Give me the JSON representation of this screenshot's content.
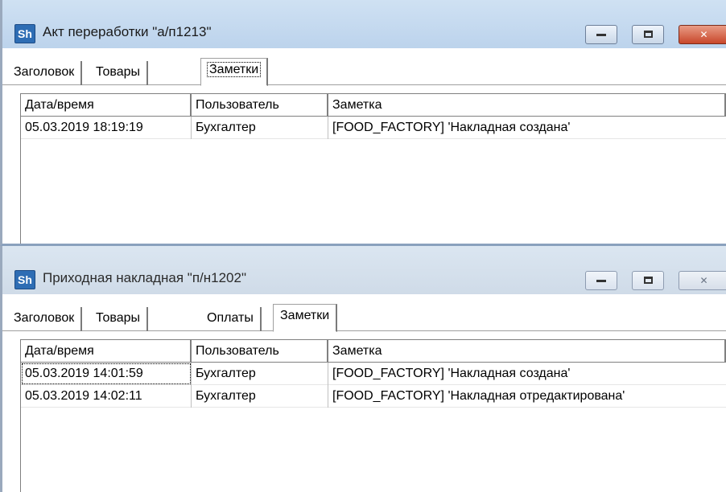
{
  "windows": [
    {
      "title": "Акт переработки \"а/п1213\"",
      "app_icon": "Sh",
      "tabs": [
        {
          "label": "Заголовок"
        },
        {
          "label": "Товары"
        },
        {
          "label": "Заметки"
        }
      ],
      "active_tab": "Заметки",
      "columns": [
        "Дата/время",
        "Пользователь",
        "Заметка"
      ],
      "rows": [
        [
          "05.03.2019 18:19:19",
          "Бухгалтер",
          "[FOOD_FACTORY] 'Накладная создана'"
        ]
      ]
    },
    {
      "title": "Приходная накладная \"п/н1202\"",
      "app_icon": "Sh",
      "tabs": [
        {
          "label": "Заголовок"
        },
        {
          "label": "Товары"
        },
        {
          "label": "Оплаты"
        },
        {
          "label": "Заметки"
        }
      ],
      "active_tab": "Заметки",
      "columns": [
        "Дата/время",
        "Пользователь",
        "Заметка"
      ],
      "rows": [
        [
          "05.03.2019 14:01:59",
          "Бухгалтер",
          "[FOOD_FACTORY] 'Накладная создана'"
        ],
        [
          "05.03.2019 14:02:11",
          "Бухгалтер",
          "[FOOD_FACTORY] 'Накладная отредактирована'"
        ]
      ]
    }
  ],
  "icons": {
    "minimize": "minimize-icon",
    "maximize": "maximize-icon",
    "close": "close-icon"
  }
}
